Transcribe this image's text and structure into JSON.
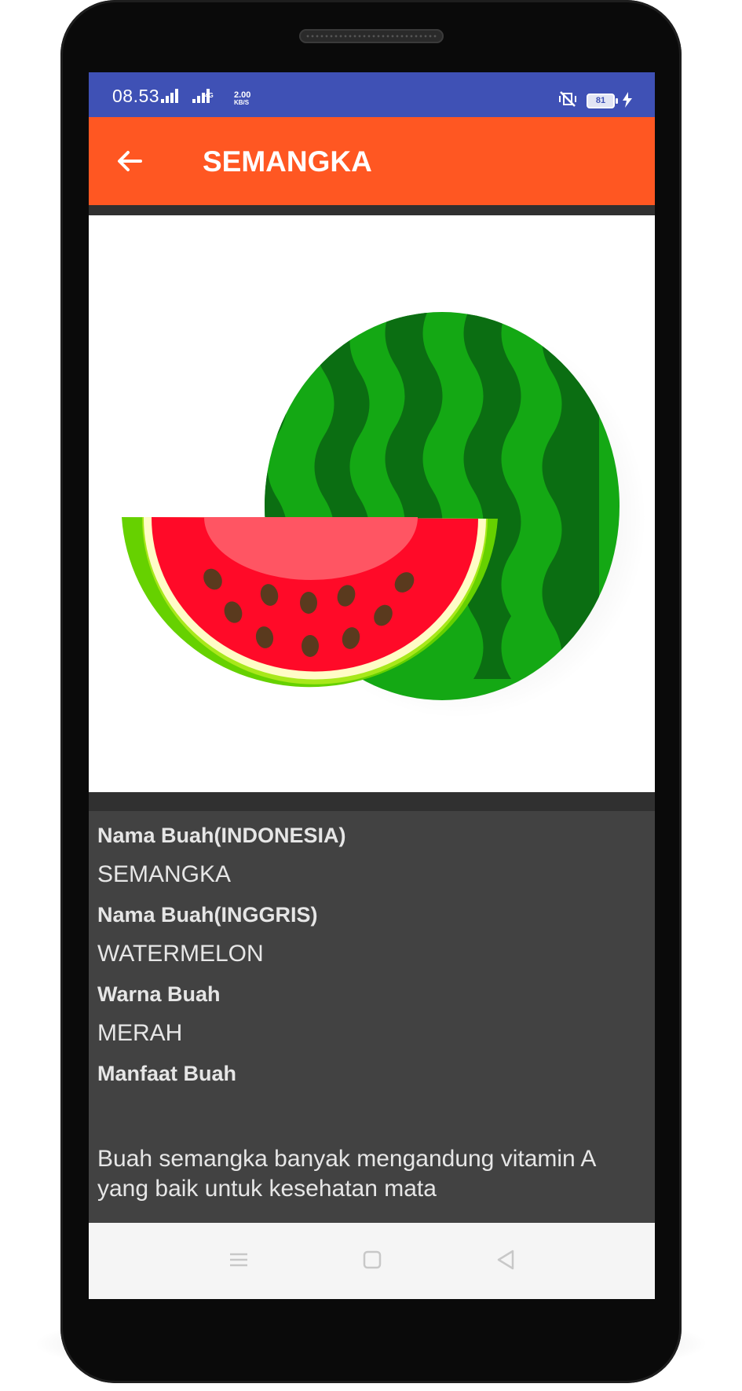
{
  "status_bar": {
    "time": "08.53",
    "network_type": "4G",
    "speed_value": "2.00",
    "speed_unit": "KB/S",
    "battery_level": "81"
  },
  "app_bar": {
    "title": "SEMANGKA"
  },
  "image": {
    "subject": "watermelon"
  },
  "details": {
    "name_id_label": "Nama Buah(INDONESIA)",
    "name_id_value": "SEMANGKA",
    "name_en_label": "Nama Buah(INGGRIS)",
    "name_en_value": "WATERMELON",
    "color_label": "Warna Buah",
    "color_value": "MERAH",
    "benefit_label": "Manfaat Buah",
    "benefit_value": "Buah semangka banyak mengandung vitamin A yang baik untuk kesehatan mata"
  },
  "nav_bar": {
    "buttons": [
      "menu",
      "home",
      "back"
    ]
  },
  "colors": {
    "status_bar": "#3f51b5",
    "app_bar": "#ff5722",
    "info_background": "#424242"
  }
}
